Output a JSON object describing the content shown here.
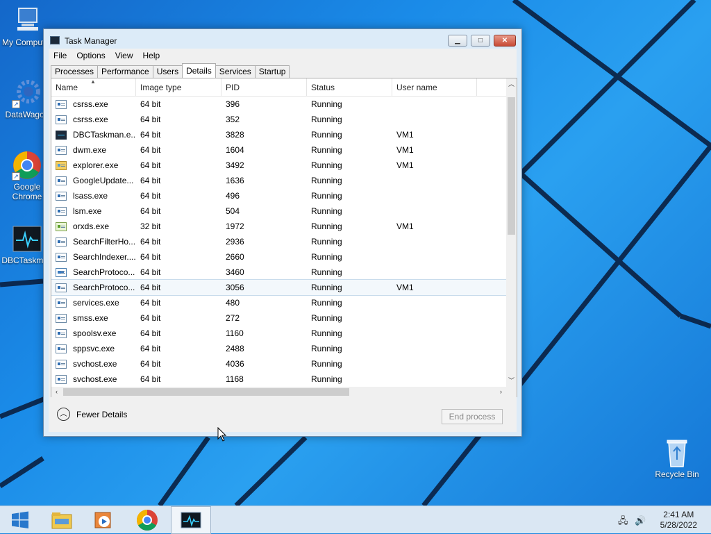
{
  "desktop": {
    "icons": [
      {
        "label": "My Computer",
        "icon": "computer-icon"
      },
      {
        "label": "DataWagon",
        "icon": "gear-icon"
      },
      {
        "label": "Google Chrome",
        "icon": "chrome-icon"
      },
      {
        "label": "DBCTaskman",
        "icon": "heartbeat-monitor-icon"
      },
      {
        "label": "Recycle Bin",
        "icon": "recycle-bin-icon"
      }
    ]
  },
  "window": {
    "title": "Task Manager",
    "controls": {
      "minimize": "▁",
      "maximize": "□",
      "close": "✕"
    },
    "menu": [
      "File",
      "Options",
      "View",
      "Help"
    ],
    "tabs": [
      "Processes",
      "Performance",
      "Users",
      "Details",
      "Services",
      "Startup"
    ],
    "active_tab": "Details",
    "columns": [
      "Name",
      "Image type",
      "PID",
      "Status",
      "User name"
    ],
    "rows": [
      {
        "name": "csrss.exe",
        "image_type": "64 bit",
        "pid": "396",
        "status": "Running",
        "user": "",
        "icon": "process-icon"
      },
      {
        "name": "csrss.exe",
        "image_type": "64 bit",
        "pid": "352",
        "status": "Running",
        "user": "",
        "icon": "process-icon"
      },
      {
        "name": "DBCTaskman.e...",
        "image_type": "64 bit",
        "pid": "3828",
        "status": "Running",
        "user": "VM1",
        "icon": "taskman-icon"
      },
      {
        "name": "dwm.exe",
        "image_type": "64 bit",
        "pid": "1604",
        "status": "Running",
        "user": "VM1",
        "icon": "process-icon"
      },
      {
        "name": "explorer.exe",
        "image_type": "64 bit",
        "pid": "3492",
        "status": "Running",
        "user": "VM1",
        "icon": "folder-icon"
      },
      {
        "name": "GoogleUpdate...",
        "image_type": "64 bit",
        "pid": "1636",
        "status": "Running",
        "user": "",
        "icon": "process-icon"
      },
      {
        "name": "lsass.exe",
        "image_type": "64 bit",
        "pid": "496",
        "status": "Running",
        "user": "",
        "icon": "process-icon"
      },
      {
        "name": "lsm.exe",
        "image_type": "64 bit",
        "pid": "504",
        "status": "Running",
        "user": "",
        "icon": "process-icon"
      },
      {
        "name": "orxds.exe",
        "image_type": "32 bit",
        "pid": "1972",
        "status": "Running",
        "user": "VM1",
        "icon": "green-check-icon"
      },
      {
        "name": "SearchFilterHo...",
        "image_type": "64 bit",
        "pid": "2936",
        "status": "Running",
        "user": "",
        "icon": "process-icon"
      },
      {
        "name": "SearchIndexer....",
        "image_type": "64 bit",
        "pid": "2660",
        "status": "Running",
        "user": "",
        "icon": "process-icon"
      },
      {
        "name": "SearchProtoco...",
        "image_type": "64 bit",
        "pid": "3460",
        "status": "Running",
        "user": "",
        "icon": "tree-icon"
      },
      {
        "name": "SearchProtoco...",
        "image_type": "64 bit",
        "pid": "3056",
        "status": "Running",
        "user": "VM1",
        "icon": "process-icon",
        "selected": true
      },
      {
        "name": "services.exe",
        "image_type": "64 bit",
        "pid": "480",
        "status": "Running",
        "user": "",
        "icon": "process-icon"
      },
      {
        "name": "smss.exe",
        "image_type": "64 bit",
        "pid": "272",
        "status": "Running",
        "user": "",
        "icon": "process-icon"
      },
      {
        "name": "spoolsv.exe",
        "image_type": "64 bit",
        "pid": "1160",
        "status": "Running",
        "user": "",
        "icon": "process-icon"
      },
      {
        "name": "sppsvc.exe",
        "image_type": "64 bit",
        "pid": "2488",
        "status": "Running",
        "user": "",
        "icon": "process-icon"
      },
      {
        "name": "svchost.exe",
        "image_type": "64 bit",
        "pid": "4036",
        "status": "Running",
        "user": "",
        "icon": "process-icon"
      },
      {
        "name": "svchost.exe",
        "image_type": "64 bit",
        "pid": "1168",
        "status": "Running",
        "user": "",
        "icon": "process-icon"
      }
    ],
    "fewer_details": "Fewer Details",
    "end_process": "End process"
  },
  "taskbar": {
    "items": [
      "start-icon",
      "file-explorer-icon",
      "media-player-icon",
      "chrome-icon",
      "task-manager-icon"
    ],
    "time": "2:41 AM",
    "date": "5/28/2022"
  }
}
